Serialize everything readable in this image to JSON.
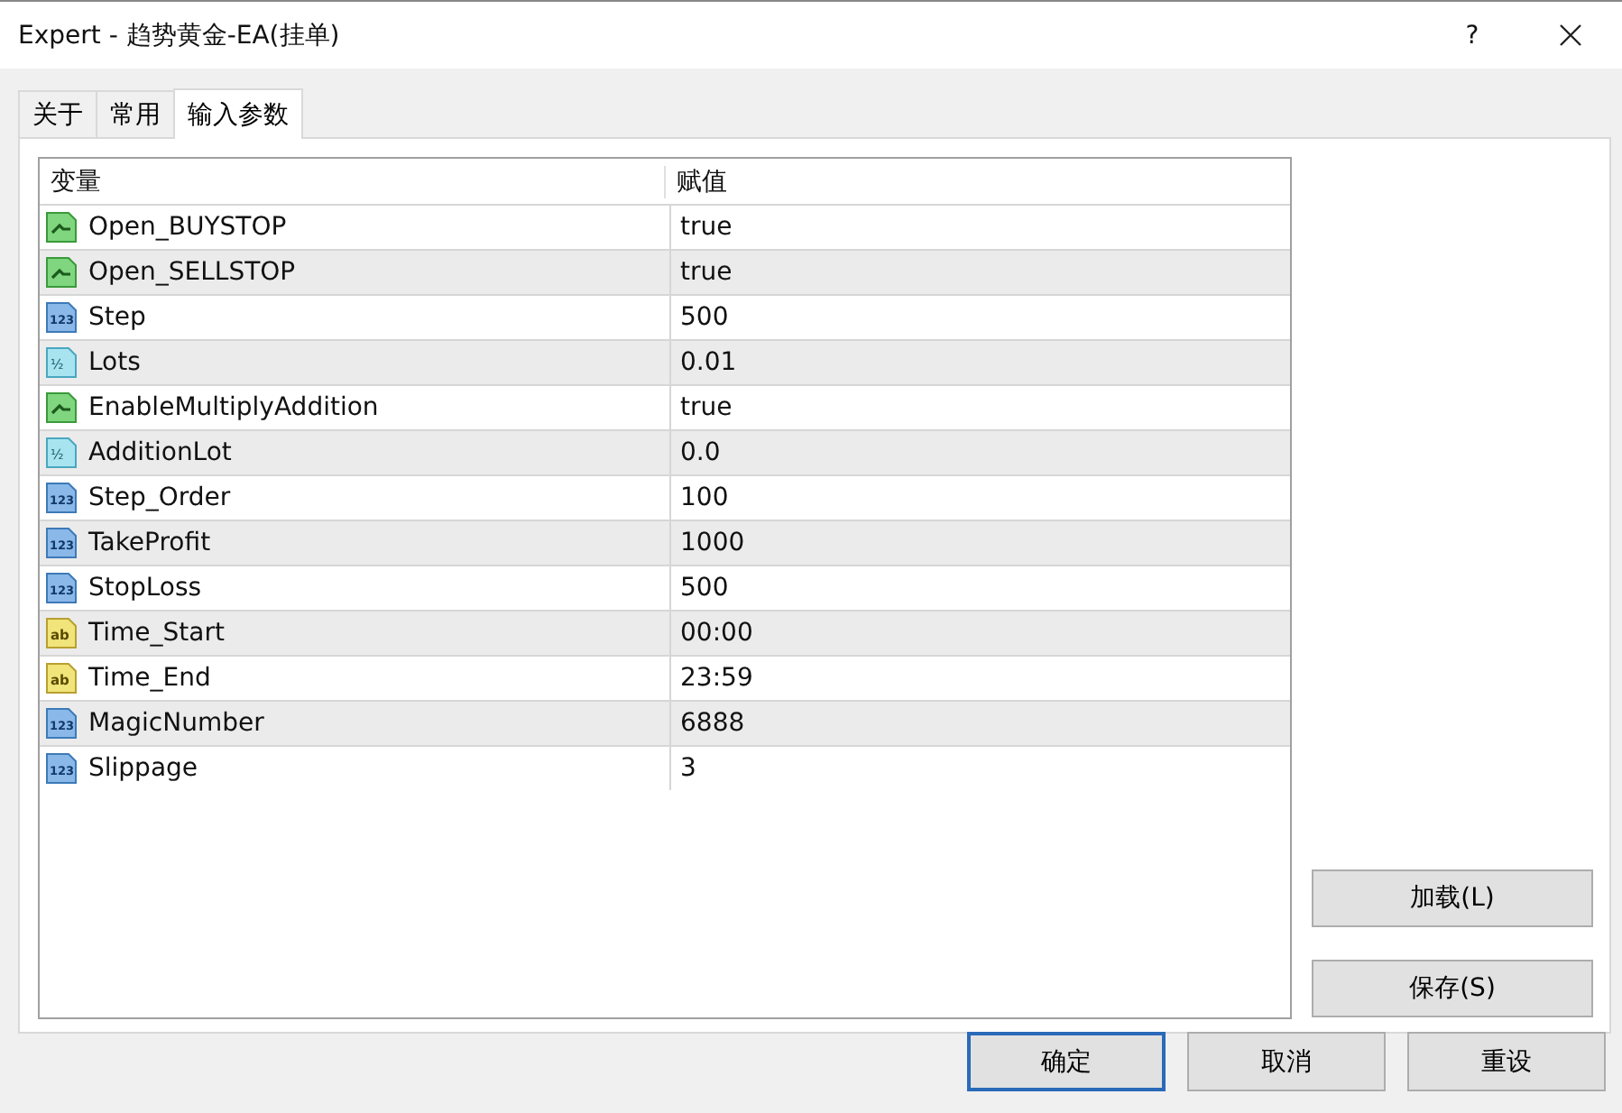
{
  "window": {
    "title": "Expert - 趋势黄金-EA(挂单)",
    "help": "?"
  },
  "tabs": [
    {
      "label": "关于",
      "selected": false
    },
    {
      "label": "常用",
      "selected": false
    },
    {
      "label": "输入参数",
      "selected": true
    }
  ],
  "table": {
    "columns": [
      "变量",
      "赋值"
    ],
    "rows": [
      {
        "kind": "bool",
        "name": "Open_BUYSTOP",
        "value": "true"
      },
      {
        "kind": "bool",
        "name": "Open_SELLSTOP",
        "value": "true"
      },
      {
        "kind": "int",
        "icon_text": "123",
        "name": "Step",
        "value": "500"
      },
      {
        "kind": "double",
        "icon_text": "½",
        "name": "Lots",
        "value": "0.01"
      },
      {
        "kind": "bool",
        "name": "EnableMultiplyAddition",
        "value": "true"
      },
      {
        "kind": "double",
        "icon_text": "½",
        "name": "AdditionLot",
        "value": "0.0"
      },
      {
        "kind": "int",
        "icon_text": "123",
        "name": "Step_Order",
        "value": "100"
      },
      {
        "kind": "int",
        "icon_text": "123",
        "name": "TakeProfit",
        "value": "1000"
      },
      {
        "kind": "int",
        "icon_text": "123",
        "name": "StopLoss",
        "value": "500"
      },
      {
        "kind": "string",
        "icon_text": "ab",
        "name": "Time_Start",
        "value": "00:00"
      },
      {
        "kind": "string",
        "icon_text": "ab",
        "name": "Time_End",
        "value": "23:59"
      },
      {
        "kind": "int",
        "icon_text": "123",
        "name": "MagicNumber",
        "value": "6888"
      },
      {
        "kind": "int",
        "icon_text": "123",
        "name": "Slippage",
        "value": "3"
      }
    ]
  },
  "side_buttons": [
    "加载(L)",
    "保存(S)"
  ],
  "buttons": [
    {
      "label": "确定",
      "default": true
    },
    {
      "label": "取消",
      "default": false
    },
    {
      "label": "重设",
      "default": false
    }
  ]
}
